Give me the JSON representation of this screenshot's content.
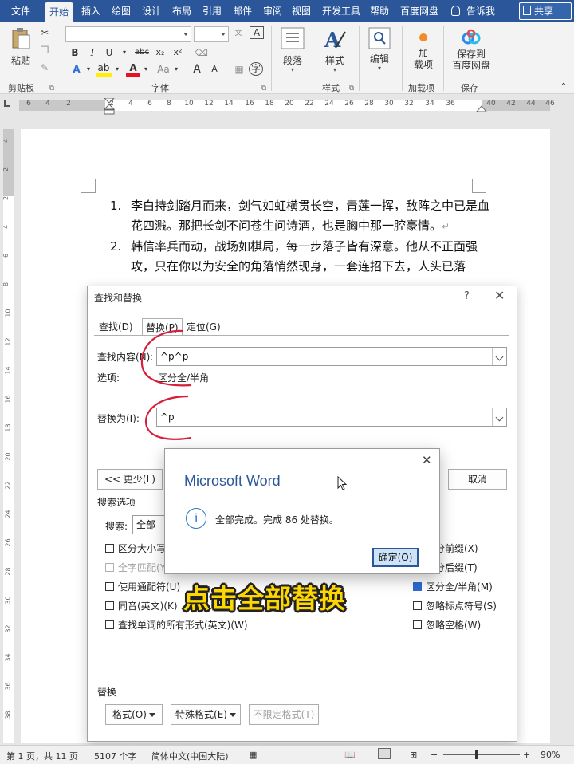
{
  "menubar": {
    "tabs": [
      "文件",
      "开始",
      "插入",
      "绘图",
      "设计",
      "布局",
      "引用",
      "邮件",
      "审阅",
      "视图",
      "开发工具",
      "帮助",
      "百度网盘"
    ],
    "active_tab": "开始",
    "tell_me": "告诉我",
    "share": "共享",
    "colors": {
      "brand": "#2b579a"
    }
  },
  "ribbon": {
    "clipboard": {
      "paste": "粘贴",
      "group": "剪贴板"
    },
    "font": {
      "group": "字体",
      "bold": "B",
      "italic": "I",
      "underline": "U",
      "strike": "abc",
      "subscript": "x₂",
      "superscript": "x²",
      "grow": "A",
      "shrink": "A",
      "case": "Aa"
    },
    "paragraph": {
      "label": "段落"
    },
    "styles": {
      "label": "样式",
      "group": "样式"
    },
    "editing": {
      "label": "编辑"
    },
    "addins": {
      "label": "加载项",
      "line1": "加",
      "line2": "载项"
    },
    "save": {
      "line1": "保存到",
      "line2": "百度网盘",
      "group": "保存"
    }
  },
  "ruler": {
    "ticks": [
      "6",
      "4",
      "2",
      "2",
      "4",
      "6",
      "8",
      "10",
      "12",
      "14",
      "16",
      "18",
      "20",
      "22",
      "24",
      "26",
      "28",
      "30",
      "32",
      "34",
      "36",
      "40",
      "42",
      "44",
      "46"
    ]
  },
  "vruler": {
    "numbers": [
      "4",
      "2",
      "2",
      "4",
      "6",
      "8",
      "10",
      "12",
      "14",
      "16",
      "18",
      "20",
      "22",
      "24",
      "26",
      "28",
      "30",
      "32",
      "34",
      "36",
      "38"
    ]
  },
  "document": {
    "items": [
      {
        "num": "1.",
        "text": "李白持剑踏月而来，剑气如虹横贯长空，青莲一挥，敌阵之中已是血花四溅。那把长剑不问苍生问诗酒，也是胸中那一腔豪情。"
      },
      {
        "num": "2.",
        "text": "韩信率兵而动，战场如棋局，每一步落子皆有深意。他从不正面强攻，只在你以为安全的角落悄然现身，一套连招下去，人头已落"
      }
    ],
    "pilcrow": "↵"
  },
  "find_replace": {
    "title": "查找和替换",
    "help": "?",
    "tabs": {
      "find": "查找(D)",
      "replace": "替换(P)",
      "goto": "定位(G)"
    },
    "find_label": "查找内容(N):",
    "find_value": "^p^p",
    "options_label": "选项:",
    "options_value": "区分全/半角",
    "replace_label": "替换为(I):",
    "replace_value": "^p",
    "less_button": "<< 更少(L)",
    "cancel_button": "取消",
    "search_options_title": "搜索选项",
    "search_label": "搜索:",
    "search_value": "全部",
    "checks_left": [
      {
        "label": "区分大小写",
        "checked": false,
        "disabled": false
      },
      {
        "label": "全字匹配(Y)",
        "checked": false,
        "disabled": true
      },
      {
        "label": "使用通配符(U)",
        "checked": false,
        "disabled": false
      },
      {
        "label": "同音(英文)(K)",
        "checked": false,
        "disabled": false
      },
      {
        "label": "查找单词的所有形式(英文)(W)",
        "checked": false,
        "disabled": false
      }
    ],
    "checks_right": [
      {
        "label": "区分前缀(X)",
        "checked": false
      },
      {
        "label": "区分后缀(T)",
        "checked": false
      },
      {
        "label": "区分全/半角(M)",
        "checked": true
      },
      {
        "label": "忽略标点符号(S)",
        "checked": false
      },
      {
        "label": "忽略空格(W)",
        "checked": false
      }
    ],
    "replace_section": "替换",
    "format_button": "格式(O)",
    "special_button": "特殊格式(E)",
    "noformat_button": "不限定格式(T)"
  },
  "message": {
    "title": "Microsoft Word",
    "text": "全部完成。完成 86 处替换。",
    "ok": "确定(O)",
    "info_glyph": "i"
  },
  "caption": "点击全部替换",
  "statusbar": {
    "page": "第 1 页，共 11 页",
    "words": "5107 个字",
    "language": "简体中文(中国大陆)",
    "minus": "−",
    "plus": "+",
    "zoom": "90%"
  }
}
